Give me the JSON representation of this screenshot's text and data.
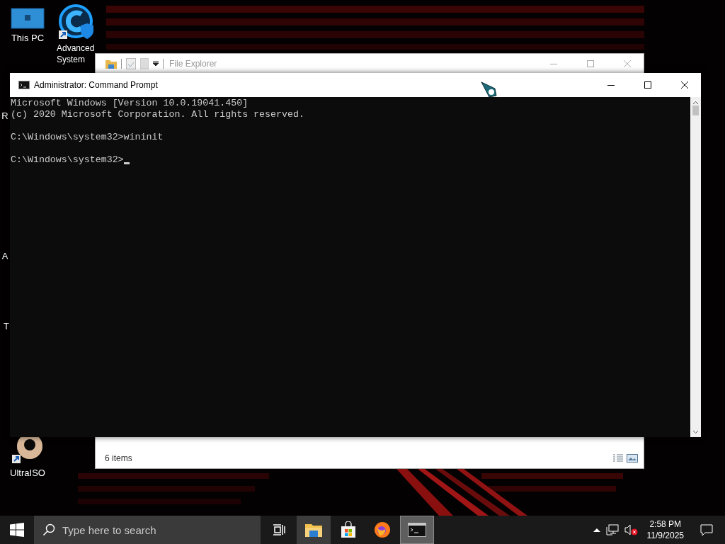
{
  "desktop": {
    "icons": [
      {
        "kind": "pc",
        "label": "This PC"
      },
      {
        "kind": "app",
        "label": "Advanced System"
      },
      {
        "kind": "hidden",
        "label": "R"
      },
      {
        "kind": "hidden",
        "label": "A"
      },
      {
        "kind": "hidden",
        "label": "T"
      },
      {
        "kind": "disc",
        "label": "UltraISO"
      }
    ]
  },
  "file_explorer": {
    "title": "File Explorer",
    "status": "6 items"
  },
  "command_prompt": {
    "title": "Administrator: Command Prompt",
    "cursor_visible": true,
    "blocks": [
      [
        "Microsoft Windows [Version 10.0.19041.450]",
        "(c) 2020 Microsoft Corporation. All rights reserved."
      ],
      [
        "C:\\Windows\\system32>wininit"
      ],
      [
        "C:\\Windows\\system32>"
      ]
    ]
  },
  "taskbar": {
    "search": {
      "placeholder": "Type here to search"
    },
    "apps": [
      {
        "kind": "task-view",
        "running": false,
        "selected": false
      },
      {
        "kind": "file-explorer",
        "running": true,
        "selected": false
      },
      {
        "kind": "store",
        "running": false,
        "selected": false
      },
      {
        "kind": "firefox",
        "running": false,
        "selected": false
      },
      {
        "kind": "terminal",
        "running": true,
        "selected": true
      }
    ],
    "time": "2:58 PM",
    "date": "11/9/2025"
  }
}
